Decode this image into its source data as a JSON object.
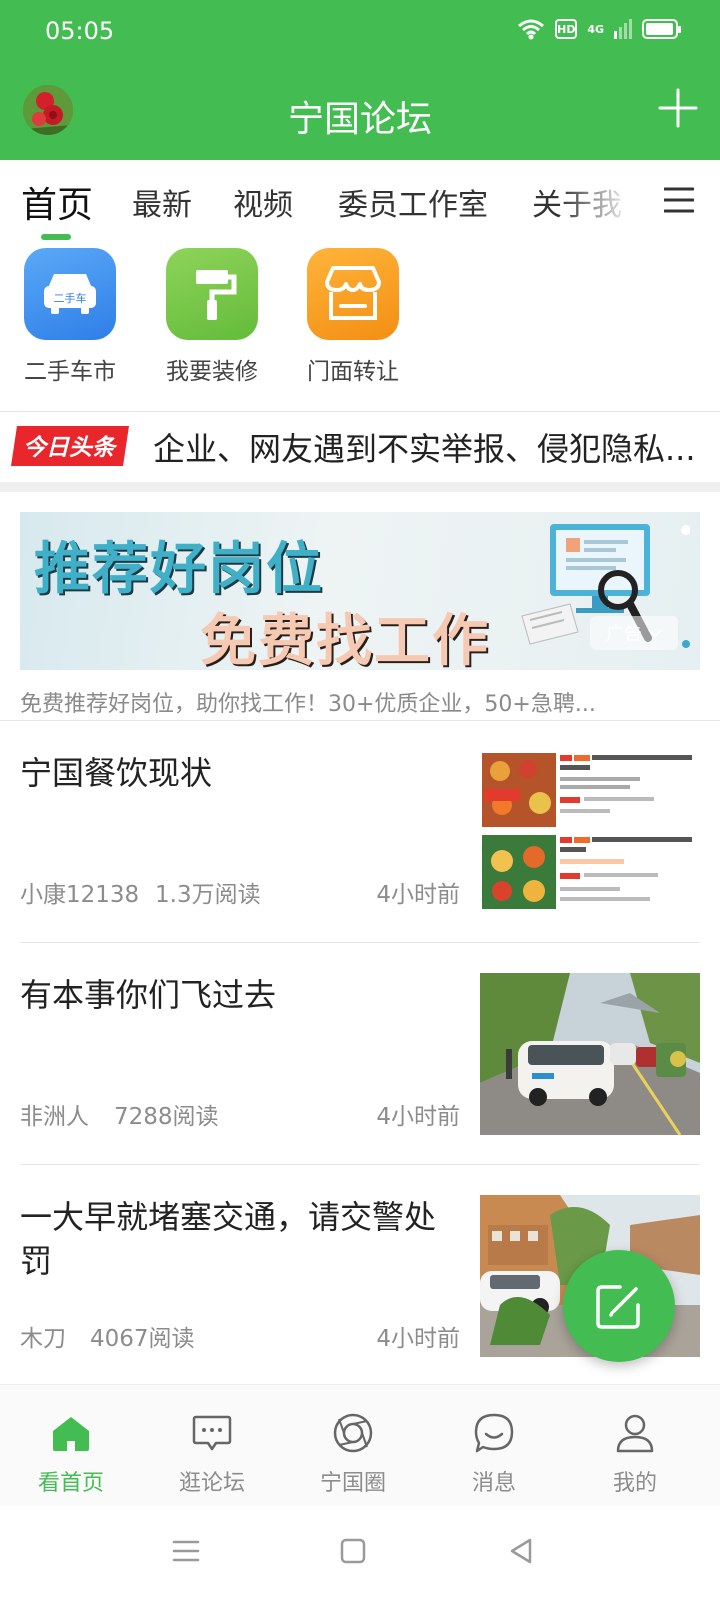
{
  "status_bar": {
    "time": "05:05",
    "hd": "HD",
    "network": "4G",
    "battery_level": 0.95
  },
  "header": {
    "title": "宁国论坛"
  },
  "tabs": [
    {
      "label": "首页",
      "active": true
    },
    {
      "label": "最新"
    },
    {
      "label": "视频"
    },
    {
      "label": "委员工作室"
    },
    {
      "label": "关于我"
    }
  ],
  "shortcuts": [
    {
      "label": "二手车市",
      "badge": "二手车",
      "color": "#3b8ff0"
    },
    {
      "label": "我要装修",
      "color": "#79c943"
    },
    {
      "label": "门面转让",
      "color": "#f7a21d"
    }
  ],
  "headline": {
    "badge": "今日头条",
    "text": "企业、网友遇到不实举报、侵犯隐私..."
  },
  "ad": {
    "line1": "推荐好岗位",
    "line2": "免费找工作",
    "tag": "广告",
    "caption": "免费推荐好岗位，助你找工作！30+优质企业，50+急聘..."
  },
  "posts": [
    {
      "title": "宁国餐饮现状",
      "author": "小康12138",
      "reads": "1.3万阅读",
      "time": "4小时前",
      "thumb": "food-listing-screenshot"
    },
    {
      "title": "有本事你们飞过去",
      "author": "非洲人",
      "reads": "7288阅读",
      "time": "4小时前",
      "thumb": "traffic-road-photo"
    },
    {
      "title": "一大早就堵塞交通，请交警处罚",
      "author": "木刀",
      "reads": "4067阅读",
      "time": "4小时前",
      "thumb": "parked-cars-street-photo"
    }
  ],
  "bottom_nav": [
    {
      "label": "看首页",
      "icon": "home-icon",
      "active": true
    },
    {
      "label": "逛论坛",
      "icon": "chat-bubble-icon"
    },
    {
      "label": "宁国圈",
      "icon": "circle-lens-icon"
    },
    {
      "label": "消息",
      "icon": "message-icon"
    },
    {
      "label": "我的",
      "icon": "user-icon"
    }
  ],
  "colors": {
    "brand_green": "#43bd52",
    "text_dark": "#222222",
    "text_meta": "#8c8c8c"
  }
}
